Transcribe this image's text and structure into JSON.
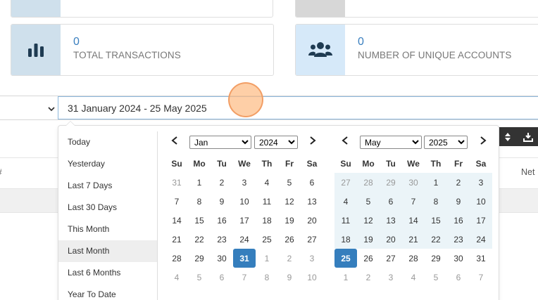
{
  "cards": {
    "transactions": {
      "value": "0",
      "label": "TOTAL TRANSACTIONS"
    },
    "accounts": {
      "value": "0",
      "label": "NUMBER OF UNIQUE ACCOUNTS"
    }
  },
  "date_range": {
    "value": "31 January 2024 - 25 May 2025"
  },
  "ranges": [
    {
      "label": "Today"
    },
    {
      "label": "Yesterday"
    },
    {
      "label": "Last 7 Days"
    },
    {
      "label": "Last 30 Days"
    },
    {
      "label": "This Month"
    },
    {
      "label": "Last Month"
    },
    {
      "label": "Last 6 Months"
    },
    {
      "label": "Year To Date"
    }
  ],
  "weekdays": [
    "Su",
    "Mo",
    "Tu",
    "We",
    "Th",
    "Fr",
    "Sa"
  ],
  "left_calendar": {
    "month": "Jan",
    "year": "2024",
    "weeks": [
      [
        "31",
        "1",
        "2",
        "3",
        "4",
        "5",
        "6"
      ],
      [
        "7",
        "8",
        "9",
        "10",
        "11",
        "12",
        "13"
      ],
      [
        "14",
        "15",
        "16",
        "17",
        "18",
        "19",
        "20"
      ],
      [
        "21",
        "22",
        "23",
        "24",
        "25",
        "26",
        "27"
      ],
      [
        "28",
        "29",
        "30",
        "31",
        "1",
        "2",
        "3"
      ],
      [
        "4",
        "5",
        "6",
        "7",
        "8",
        "9",
        "10"
      ]
    ]
  },
  "right_calendar": {
    "month": "May",
    "year": "2025",
    "weeks": [
      [
        "27",
        "28",
        "29",
        "30",
        "1",
        "2",
        "3"
      ],
      [
        "4",
        "5",
        "6",
        "7",
        "8",
        "9",
        "10"
      ],
      [
        "11",
        "12",
        "13",
        "14",
        "15",
        "16",
        "17"
      ],
      [
        "18",
        "19",
        "20",
        "21",
        "22",
        "23",
        "24"
      ],
      [
        "25",
        "26",
        "27",
        "28",
        "29",
        "30",
        "31"
      ],
      [
        "1",
        "2",
        "3",
        "4",
        "5",
        "6",
        "7"
      ]
    ]
  },
  "table": {
    "net_header": "Net",
    "left_header": "#"
  },
  "colors": {
    "accent": "#357ebd",
    "range_bg": "#ebf4f8",
    "value_blue": "#3a7fbf"
  }
}
